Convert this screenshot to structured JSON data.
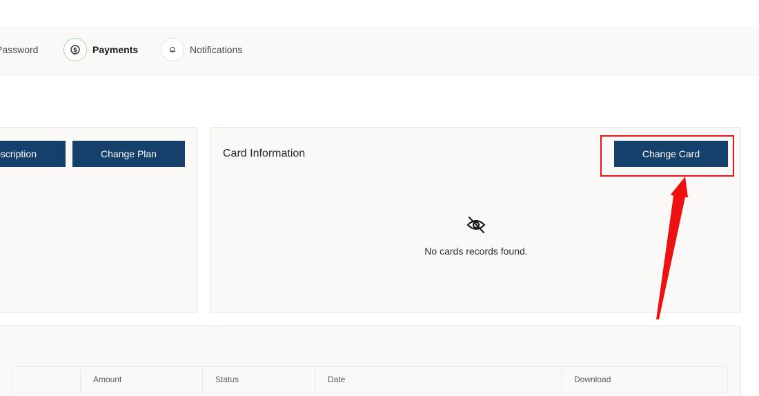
{
  "tabs": [
    {
      "label": "Password",
      "icon": "lock-icon"
    },
    {
      "label": "Payments",
      "icon": "payment-icon",
      "active": true
    },
    {
      "label": "Notifications",
      "icon": "bell-icon"
    }
  ],
  "subscription": {
    "cancel_label": "Cancel Subscription",
    "change_plan_label": "Change Plan"
  },
  "card": {
    "title": "Card Information",
    "change_card_label": "Change Card",
    "empty_icon": "eye-off-icon",
    "empty_text": "No cards records found."
  },
  "history": {
    "columns": [
      "",
      "Amount",
      "Status",
      "Date",
      "Download"
    ]
  },
  "colors": {
    "primary": "#15406c",
    "annotation": "#ee1111",
    "active_tab_ring": "#a9d4a2"
  }
}
